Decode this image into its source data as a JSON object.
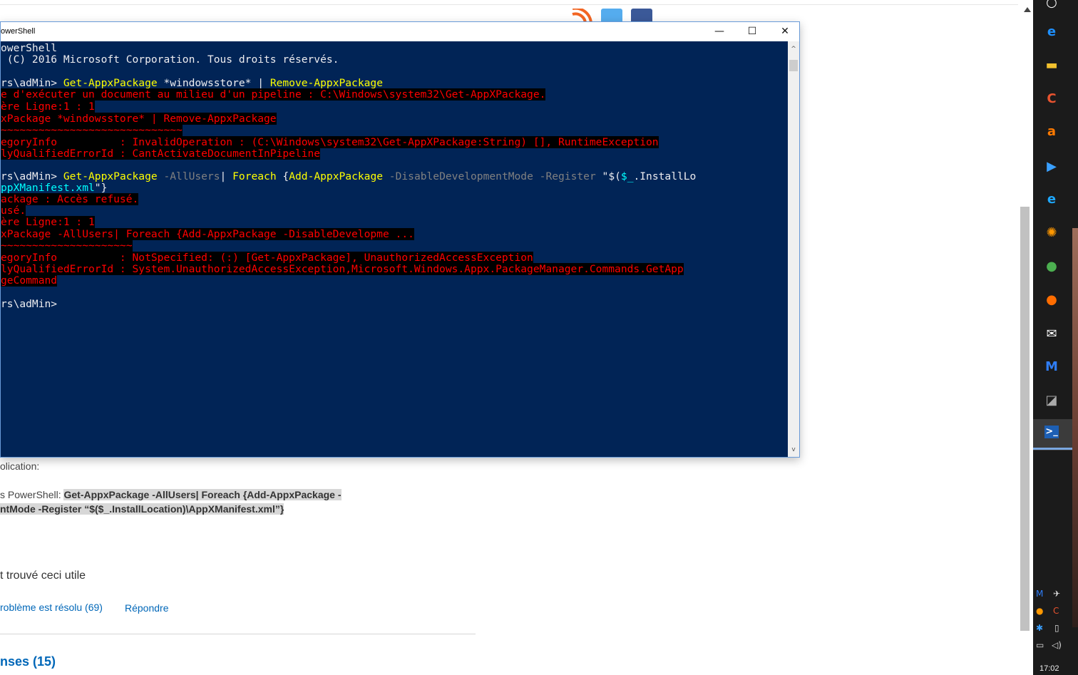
{
  "window": {
    "title": "owerShell",
    "controls": {
      "minimize": "—",
      "maximize": "☐",
      "close": "✕"
    },
    "scroll_up": "^",
    "scroll_down": "v"
  },
  "console": {
    "lines": [
      [
        {
          "t": "owerShell",
          "c": "w"
        }
      ],
      [
        {
          "t": " (C) 2016 Microsoft Corporation. Tous droits réservés.",
          "c": "w"
        }
      ],
      [],
      [
        {
          "t": "rs\\adMin> ",
          "c": "w"
        },
        {
          "t": "Get-AppxPackage",
          "c": "y"
        },
        {
          "t": " *windowsstore* | ",
          "c": "w"
        },
        {
          "t": "Remove-AppxPackage",
          "c": "y"
        }
      ],
      [
        {
          "t": "e d'exécuter un document au milieu d'un pipeline : C:\\Windows\\system32\\Get-AppXPackage.",
          "c": "err"
        }
      ],
      [
        {
          "t": "ère Ligne:1 : 1",
          "c": "err"
        }
      ],
      [
        {
          "t": "xPackage *windowsstore* | Remove-AppxPackage",
          "c": "err"
        }
      ],
      [
        {
          "t": "~~~~~~~~~~~~~~~~~~~~~~~~~~~~~",
          "c": "err"
        }
      ],
      [
        {
          "t": "egoryInfo          : InvalidOperation : (C:\\Windows\\system32\\Get-AppXPackage:String) [], RuntimeException",
          "c": "err"
        }
      ],
      [
        {
          "t": "lyQualifiedErrorId : CantActivateDocumentInPipeline",
          "c": "err"
        }
      ],
      [],
      [
        {
          "t": "rs\\adMin> ",
          "c": "w"
        },
        {
          "t": "Get-AppxPackage",
          "c": "y"
        },
        {
          "t": " -AllUsers",
          "c": "g"
        },
        {
          "t": "| ",
          "c": "w"
        },
        {
          "t": "Foreach",
          "c": "y"
        },
        {
          "t": " {",
          "c": "w"
        },
        {
          "t": "Add-AppxPackage",
          "c": "y"
        },
        {
          "t": " -DisableDevelopmentMode -Register ",
          "c": "g"
        },
        {
          "t": "\"$(",
          "c": "w"
        },
        {
          "t": "$_",
          "c": "c"
        },
        {
          "t": ".InstallLo",
          "c": "w"
        }
      ],
      [
        {
          "t": "ppXManifest.xml",
          "c": "c"
        },
        {
          "t": "\"}",
          "c": "w"
        }
      ],
      [
        {
          "t": "ackage : Accès refusé.",
          "c": "err"
        }
      ],
      [
        {
          "t": "usé.",
          "c": "err"
        }
      ],
      [
        {
          "t": "ère Ligne:1 : 1",
          "c": "err"
        }
      ],
      [
        {
          "t": "xPackage -AllUsers| Foreach {Add-AppxPackage -DisableDevelopme ...",
          "c": "err"
        }
      ],
      [
        {
          "t": "~~~~~~~~~~~~~~~~~~~~~",
          "c": "err"
        }
      ],
      [
        {
          "t": "egoryInfo          : NotSpecified: (:) [Get-AppxPackage], UnauthorizedAccessException",
          "c": "err"
        }
      ],
      [
        {
          "t": "lyQualifiedErrorId : System.UnauthorizedAccessException,Microsoft.Windows.Appx.PackageManager.Commands.GetApp",
          "c": "err"
        }
      ],
      [
        {
          "t": "geCommand",
          "c": "err"
        }
      ],
      [],
      [
        {
          "t": "rs\\adMin>",
          "c": "w"
        }
      ]
    ]
  },
  "page": {
    "application_label": "olication:",
    "powershell_prefix": "s PowerShell: ",
    "code_line1": "Get-AppxPackage -AllUsers| Foreach {Add-AppxPackage -",
    "code_line2": "ntMode -Register “$($_.InstallLocation)\\AppXManifest.xml”}",
    "helpful_text": "t trouvé ceci utile",
    "resolved_link": "roblème est résolu (69)",
    "reply_link": "Répondre",
    "answers_heading": "nses (15)"
  },
  "colors": {
    "console_bg": "#012456",
    "console_text": "#eeedf0",
    "cmdlet": "#ffff00",
    "parameter": "#808080",
    "variable": "#00ffff",
    "error": "#ff0000",
    "link": "#0067b8"
  },
  "taskbar": {
    "icons": [
      "cortana-icon",
      "edge-icon",
      "file-explorer-icon",
      "ccleaner-icon",
      "avast-icon",
      "media-player-icon",
      "internet-explorer-icon",
      "update-icon",
      "chrome-icon",
      "firefox-icon",
      "mail-icon",
      "malwarebytes-icon",
      "gpu-tool-icon",
      "powershell-icon"
    ],
    "clock": "17:02"
  }
}
